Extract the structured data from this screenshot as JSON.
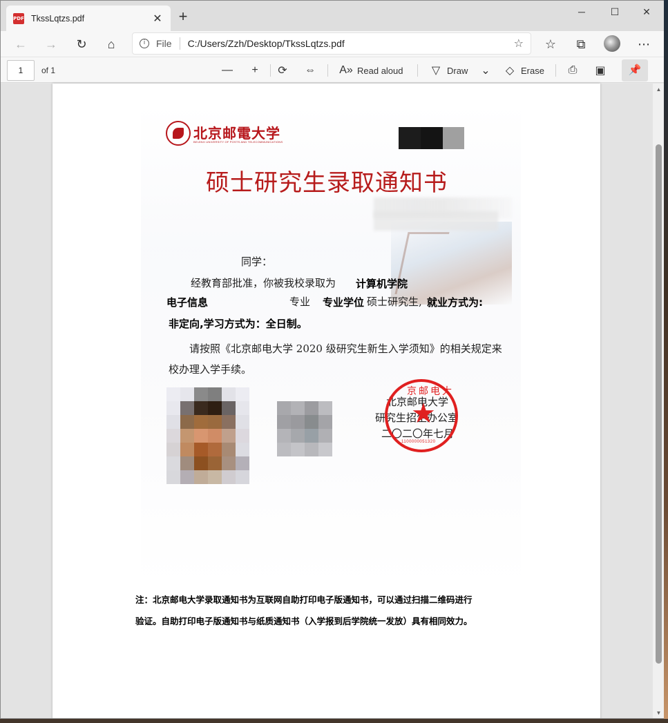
{
  "browser": {
    "tab_title": "TkssLqtzs.pdf",
    "tab_icon": "pdf-icon",
    "address": {
      "scheme": "File",
      "url": "C:/Users/Zzh/Desktop/TkssLqtzs.pdf"
    }
  },
  "pdf_toolbar": {
    "page_number": "1",
    "page_of": "of 1",
    "read_aloud_label": "Read aloud",
    "draw_label": "Draw",
    "erase_label": "Erase"
  },
  "document": {
    "logo_text": "北京邮電大学",
    "logo_subtitle": "BEIJING UNIVERSITY OF POSTS AND TELECOMMUNICATIONS",
    "title": "硕士研究生录取通知书",
    "salutation": "同学：",
    "line1_prefix": "经教育部批准，你被我校录取为",
    "line1_school": "计算机学院",
    "line2_major": "电子信息",
    "line2_mid": "专业",
    "line2_degree": "专业学位",
    "line2_suffix": "硕士研究生,",
    "line2_employ": "就业方式为:",
    "line3": "非定向,学习方式为：全日制。",
    "para2_line1": "请按照《北京邮电大学 2020 级研究生新生入学须知》的相关规定来",
    "para2_line2": "校办理入学手续。",
    "sign_line1": "北京邮电大学",
    "sign_line2": "研究生招生办公室",
    "sign_line3": "二〇二〇年七月",
    "stamp_top": "京邮电大",
    "stamp_bottom": "1100000051320",
    "note_line1": "注：北京邮电大学录取通知书为互联网自助打印电子版通知书，可以通过扫描二维码进行",
    "note_line2": "验证。自助打印电子版通知书与纸质通知书（入学报到后学院统一发放）具有相同效力。"
  },
  "colors": {
    "brand_red": "#b71c1c",
    "stamp_red": "#e02020",
    "toolbar_bg": "#f7f7f7"
  }
}
